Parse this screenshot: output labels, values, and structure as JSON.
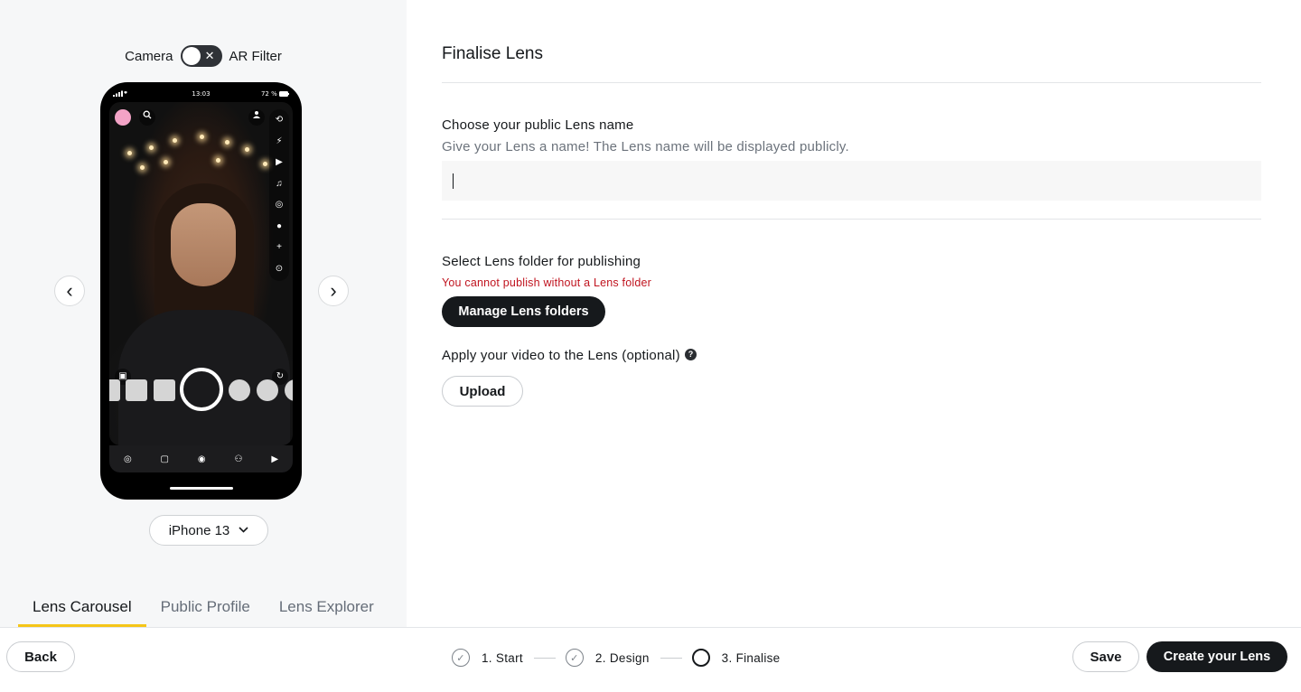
{
  "preview": {
    "toggle_left": "Camera",
    "toggle_right": "AR Filter",
    "toggle_x": "✕",
    "phone_time": "13:03",
    "phone_battery": "72 %",
    "device": "iPhone 13",
    "prev_arrow": "‹",
    "next_arrow": "›"
  },
  "tabs": [
    {
      "label": "Lens Carousel",
      "active": true
    },
    {
      "label": "Public Profile",
      "active": false
    },
    {
      "label": "Lens Explorer",
      "active": false
    }
  ],
  "form": {
    "title": "Finalise Lens",
    "name_label": "Choose your public Lens name",
    "name_hint": "Give your Lens a name! The Lens name will be displayed publicly.",
    "name_value": "",
    "folder_label": "Select Lens folder for publishing",
    "folder_error": "You cannot publish without a Lens folder",
    "manage_button": "Manage Lens folders",
    "video_label": "Apply your video to the Lens (optional)",
    "help_glyph": "?",
    "upload_button": "Upload"
  },
  "footer": {
    "back": "Back",
    "steps": [
      {
        "label": "1. Start",
        "status": "done"
      },
      {
        "label": "2. Design",
        "status": "done"
      },
      {
        "label": "3. Finalise",
        "status": "current"
      }
    ],
    "check_glyph": "✓",
    "save": "Save",
    "create": "Create your Lens"
  },
  "colors": {
    "accent_tab": "#f5c518",
    "error": "#c0141f",
    "primary_button": "#16191c"
  }
}
